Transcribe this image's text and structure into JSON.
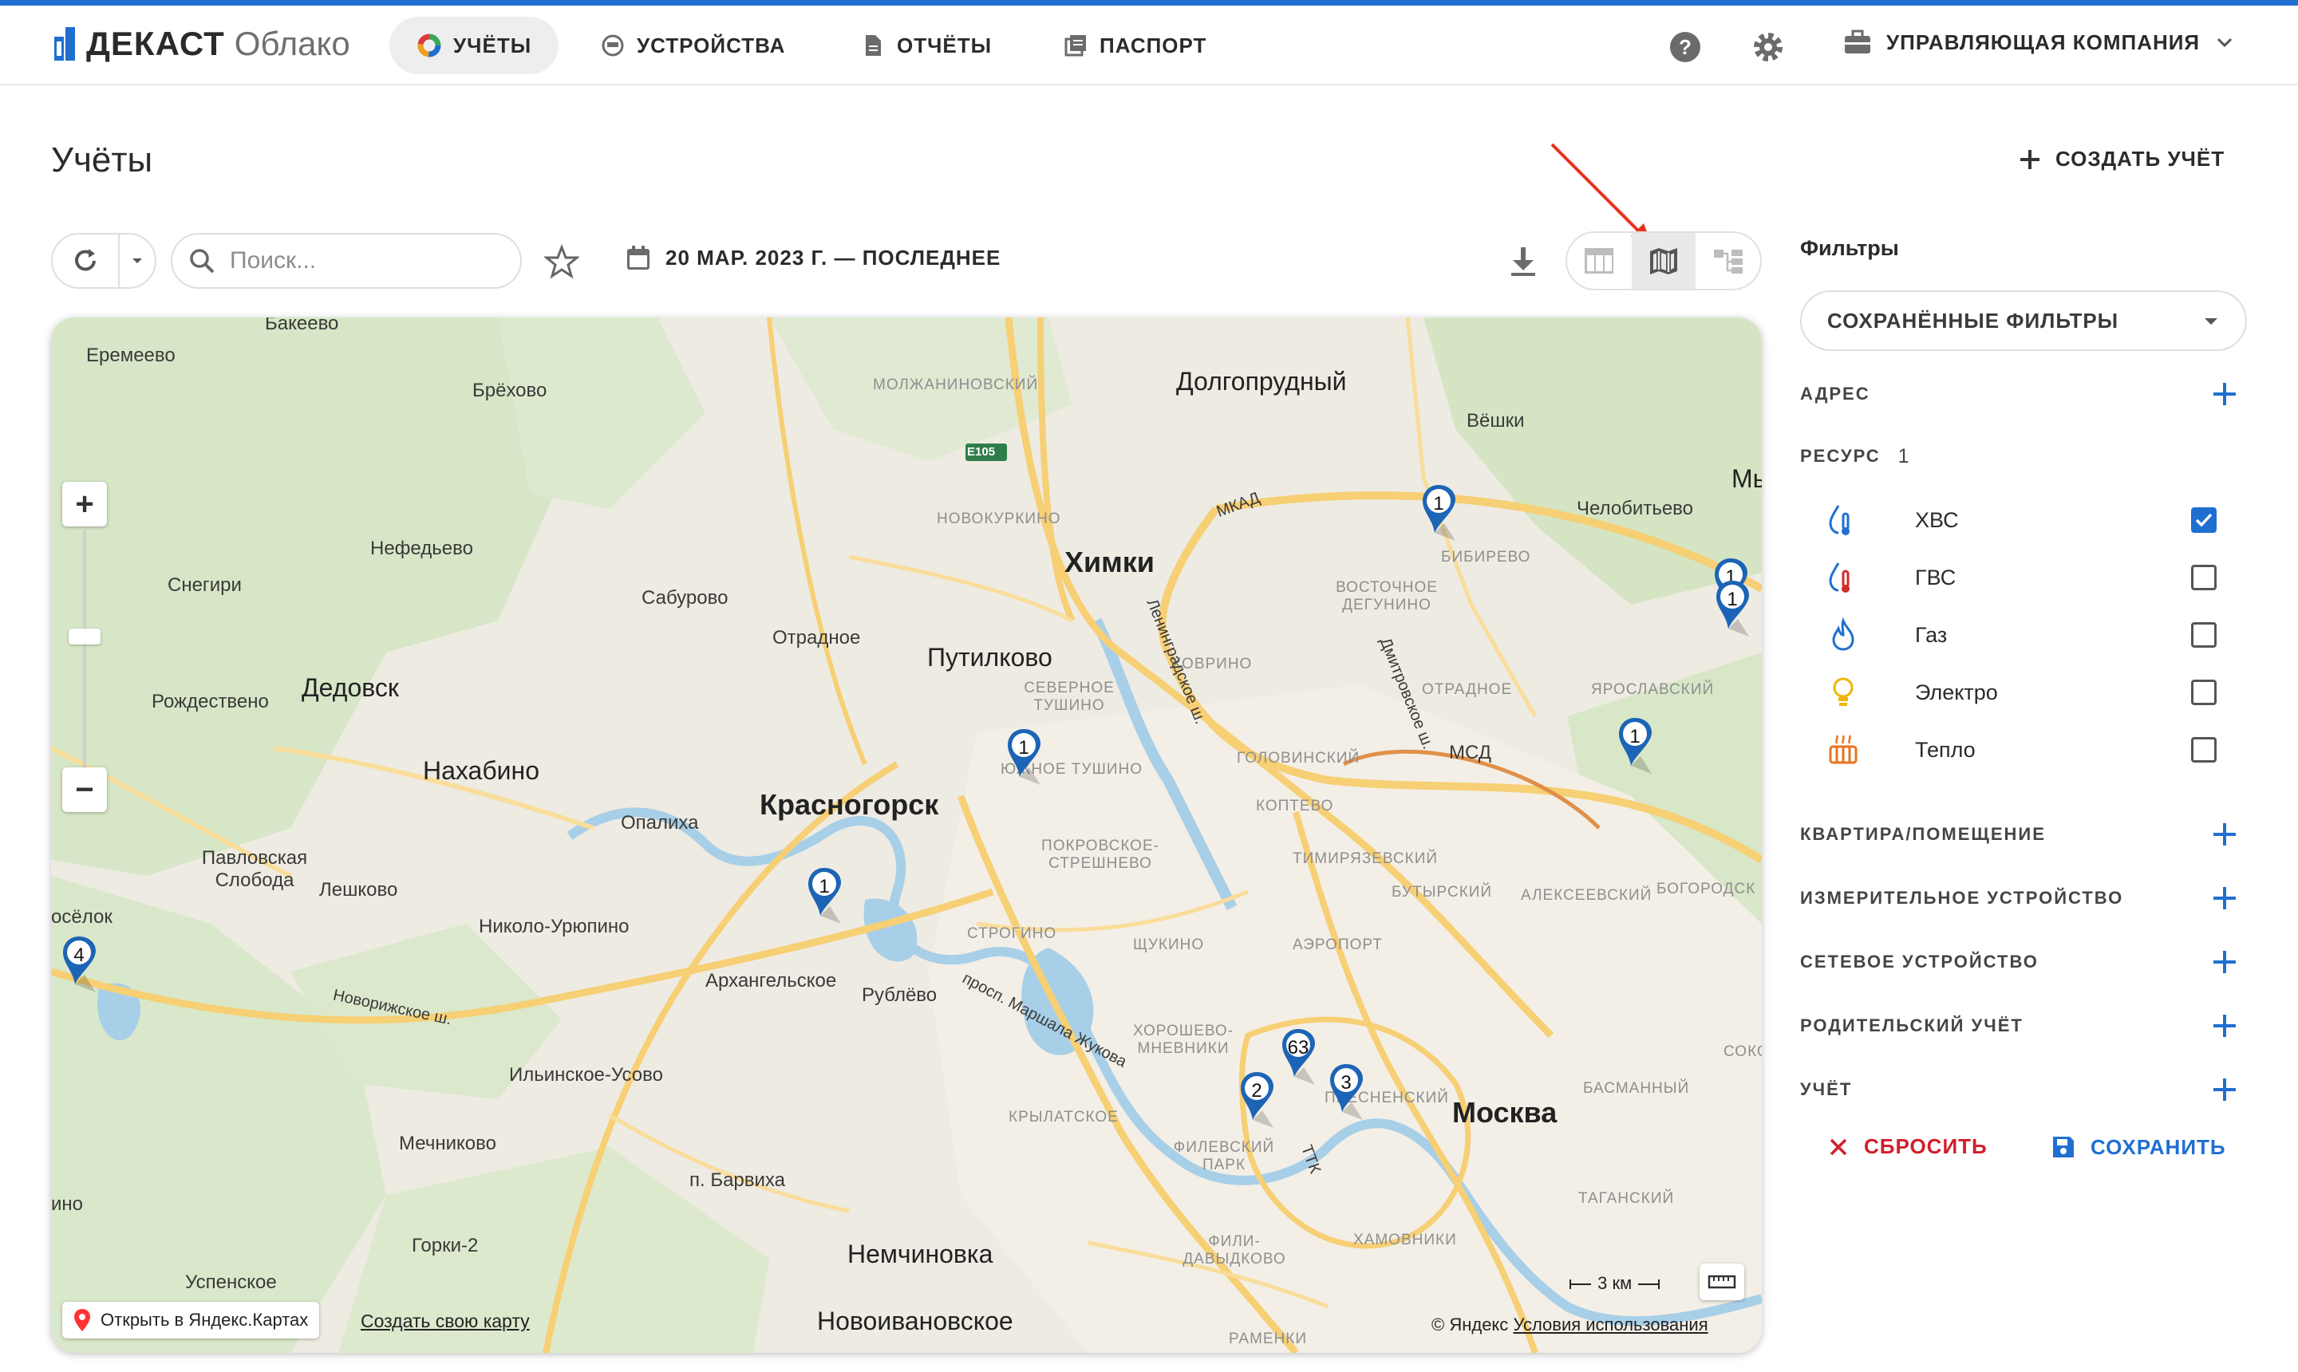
{
  "header": {
    "logo_brand": "ДЕКАСТ",
    "logo_sub": "Облако",
    "nav": [
      {
        "label": "УЧЁТЫ",
        "icon": "donut-chart-icon",
        "active": true
      },
      {
        "label": "УСТРОЙСТВА",
        "icon": "meter-device-icon",
        "active": false
      },
      {
        "label": "ОТЧЁТЫ",
        "icon": "document-icon",
        "active": false
      },
      {
        "label": "ПАСПОРТ",
        "icon": "passport-icon",
        "active": false
      }
    ],
    "help_icon": "help-icon",
    "settings_icon": "gear-icon",
    "company_label": "УПРАВЛЯЮЩАЯ КОМПАНИЯ",
    "accent_color": "#1e6fd0"
  },
  "page": {
    "title": "Учёты",
    "create_label": "СОЗДАТЬ УЧЁТ"
  },
  "toolbar": {
    "search_placeholder": "Поиск...",
    "date_range": "20 МАР. 2023 Г. — ПОСЛЕДНЕЕ",
    "views": [
      "table-view-icon",
      "map-view-icon",
      "tree-view-icon"
    ],
    "active_view": "map-view-icon"
  },
  "map": {
    "labels": [
      {
        "text": "Бакеево",
        "cls": ""
      },
      {
        "text": "Еремеево",
        "cls": ""
      },
      {
        "text": "Брёхово",
        "cls": ""
      },
      {
        "text": "МОЛЖАНИНОВСКИЙ",
        "cls": "district"
      },
      {
        "text": "Долгопрудный",
        "cls": "city"
      },
      {
        "text": "Вёшки",
        "cls": ""
      },
      {
        "text": "Мы",
        "cls": "city"
      },
      {
        "text": "НОВОКУРКИНО",
        "cls": "district"
      },
      {
        "text": "Челобитьево",
        "cls": ""
      },
      {
        "text": "Химки",
        "cls": "big"
      },
      {
        "text": "БИБИРЕВО",
        "cls": "district"
      },
      {
        "text": "Нефедьево",
        "cls": ""
      },
      {
        "text": "Снегири",
        "cls": ""
      },
      {
        "text": "Сабурово",
        "cls": ""
      },
      {
        "text": "ВОСТОЧНОЕ ДЕГУНИНО",
        "cls": "district"
      },
      {
        "text": "Отрадное",
        "cls": ""
      },
      {
        "text": "Путилково",
        "cls": "city"
      },
      {
        "text": "ХОВРИНО",
        "cls": "district"
      },
      {
        "text": "Дедовск",
        "cls": "city"
      },
      {
        "text": "СЕВЕРНОЕ ТУШИНО",
        "cls": "district"
      },
      {
        "text": "ОТРАДНОЕ",
        "cls": "district"
      },
      {
        "text": "ЯРОСЛАВСКИЙ",
        "cls": "district"
      },
      {
        "text": "Рождествено",
        "cls": ""
      },
      {
        "text": "Нахабино",
        "cls": "city"
      },
      {
        "text": "ЮЖНОЕ ТУШИНО",
        "cls": "district"
      },
      {
        "text": "ГОЛОВИНСКИЙ",
        "cls": "district"
      },
      {
        "text": "МСД",
        "cls": ""
      },
      {
        "text": "Красногорск",
        "cls": "big"
      },
      {
        "text": "Опалиха",
        "cls": ""
      },
      {
        "text": "КОПТЕВО",
        "cls": "district"
      },
      {
        "text": "ПОКРОВСКОЕ-СТРЕШНЕВО",
        "cls": "district"
      },
      {
        "text": "ТИМИРЯЗЕВСКИЙ",
        "cls": "district"
      },
      {
        "text": "Павловская Слобода",
        "cls": ""
      },
      {
        "text": "Лешково",
        "cls": ""
      },
      {
        "text": "БУТЫРСКИЙ",
        "cls": "district"
      },
      {
        "text": "АЛЕКСЕЕВСКИЙ",
        "cls": "district"
      },
      {
        "text": "БОГОРОДСК",
        "cls": "district"
      },
      {
        "text": "осёлок",
        "cls": ""
      },
      {
        "text": "Николо-Урюпино",
        "cls": ""
      },
      {
        "text": "СТРОГИНО",
        "cls": "district"
      },
      {
        "text": "ЩУКИНО",
        "cls": "district"
      },
      {
        "text": "АЭРОПОРТ",
        "cls": "district"
      },
      {
        "text": "Архангельское",
        "cls": ""
      },
      {
        "text": "Рублёво",
        "cls": ""
      },
      {
        "text": "Новорижское ш.",
        "cls": ""
      },
      {
        "text": "просп. Маршала Жукова",
        "cls": ""
      },
      {
        "text": "ХОРОШЕВО-МНЕВНИКИ",
        "cls": "district"
      },
      {
        "text": "СОКО",
        "cls": "district"
      },
      {
        "text": "Ильинское-Усово",
        "cls": ""
      },
      {
        "text": "ПРЕСНЕНСКИЙ",
        "cls": "district"
      },
      {
        "text": "Москва",
        "cls": "big"
      },
      {
        "text": "БАСМАННЫЙ",
        "cls": "district"
      },
      {
        "text": "КРЫЛАТСКОЕ",
        "cls": "district"
      },
      {
        "text": "Мечниково",
        "cls": ""
      },
      {
        "text": "ФИЛЕВСКИЙ ПАРК",
        "cls": "district"
      },
      {
        "text": "п. Барвиха",
        "cls": ""
      },
      {
        "text": "ТАГАНСКИЙ",
        "cls": "district"
      },
      {
        "text": "ино",
        "cls": ""
      },
      {
        "text": "Горки-2",
        "cls": ""
      },
      {
        "text": "ХАМОВНИКИ",
        "cls": "district"
      },
      {
        "text": "ФИЛИ-ДАВЫДКОВО",
        "cls": "district"
      },
      {
        "text": "Немчиновка",
        "cls": "city"
      },
      {
        "text": "Успенское",
        "cls": ""
      },
      {
        "text": "Новоивановское",
        "cls": "city"
      },
      {
        "text": "РАМЕНКИ",
        "cls": "district"
      },
      {
        "text": "МКАД",
        "cls": ""
      },
      {
        "text": "Ленинградское ш.",
        "cls": ""
      },
      {
        "text": "Дмитровское ш.",
        "cls": ""
      },
      {
        "text": "ТТК",
        "cls": ""
      },
      {
        "text": "E105",
        "cls": ""
      }
    ],
    "markers": [
      "1",
      "1",
      "1",
      "1",
      "1",
      "4",
      "1",
      "2",
      "63",
      "3"
    ],
    "open_yandex": "Открыть в Яндекс.Картах",
    "create_map": "Создать свою карту",
    "scale": "3 км",
    "copyright": "© Яндекс",
    "terms": "Условия использования"
  },
  "filters": {
    "title": "Фильтры",
    "saved_filters": "СОХРАНЁННЫЕ ФИЛЬТРЫ",
    "address": "АДРЕС",
    "resource": "РЕСУРС",
    "resource_count": "1",
    "resources": [
      {
        "name": "ХВС",
        "icon": "cold-water-icon",
        "checked": true
      },
      {
        "name": "ГВС",
        "icon": "hot-water-icon",
        "checked": false
      },
      {
        "name": "Газ",
        "icon": "gas-flame-icon",
        "checked": false
      },
      {
        "name": "Электро",
        "icon": "bulb-icon",
        "checked": false
      },
      {
        "name": "Тепло",
        "icon": "heat-icon",
        "checked": false
      }
    ],
    "apartment": "КВАРТИРА/ПОМЕЩЕНИЕ",
    "meter": "ИЗМЕРИТЕЛЬНОЕ УСТРОЙСТВО",
    "network": "СЕТЕВОЕ УСТРОЙСТВО",
    "parent": "РОДИТЕЛЬСКИЙ УЧЁТ",
    "account": "УЧЁТ",
    "reset_label": "СБРОСИТЬ",
    "save_label": "СОХРАНИТЬ",
    "check_color": "#1f6fd1",
    "reset_color": "#d21d2b"
  }
}
